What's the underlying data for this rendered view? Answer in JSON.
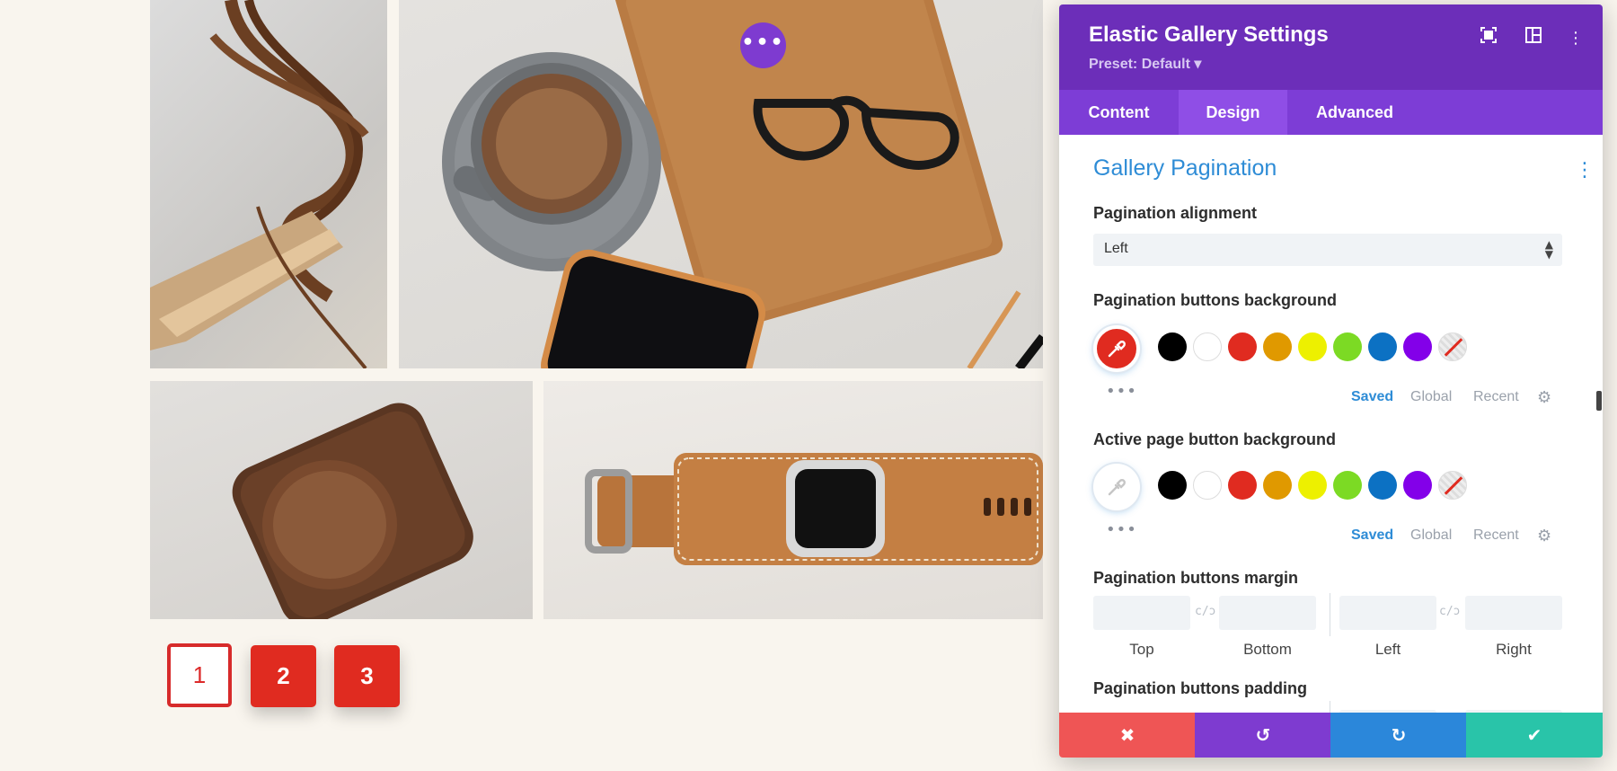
{
  "gallery": {
    "images": [
      "leather-laces-photo",
      "coffee-notebook-glasses-photo",
      "leather-camera-case-photo",
      "leather-watch-strap-photo"
    ],
    "edit_icon": "more-horizontal-icon",
    "pagination": [
      "1",
      "2",
      "3"
    ],
    "active_page": "1",
    "colors": {
      "button_red": "#e02b20",
      "active_border": "#d72b2b"
    }
  },
  "panel": {
    "title": "Elastic Gallery Settings",
    "preset": "Preset: Default ▾",
    "header_icons": [
      "expand-icon",
      "split-view-icon",
      "kebab-menu-icon"
    ],
    "tabs": [
      "Content",
      "Design",
      "Advanced"
    ],
    "active_tab": "Design",
    "section_title": "Gallery Pagination",
    "alignment": {
      "label": "Pagination alignment",
      "value": "Left"
    },
    "buttons_background": {
      "label": "Pagination buttons background",
      "selected_color": "#e02b20"
    },
    "active_background": {
      "label": "Active page button background",
      "selected_color": "#ffffff"
    },
    "swatches": [
      "#000000",
      "#ffffff",
      "#e02b20",
      "#e09900",
      "#edf000",
      "#7cda24",
      "#0c71c3",
      "#8300e9"
    ],
    "color_tabs": {
      "saved": "Saved",
      "global": "Global",
      "recent": "Recent"
    },
    "margin": {
      "label": "Pagination buttons margin",
      "fields": [
        "Top",
        "Bottom",
        "Left",
        "Right"
      ],
      "link_glyph": "c/ɔ"
    },
    "padding": {
      "label": "Pagination buttons padding"
    },
    "footer_icons": [
      "close-icon",
      "undo-icon",
      "redo-icon",
      "check-icon"
    ],
    "colors": {
      "header": "#6c2eb9",
      "tabs": "#7d3dd6",
      "active_tab": "#8f4ee6",
      "section_title": "#2e8cd6",
      "footer_cancel": "#ef5555",
      "footer_undo": "#7e3bd0",
      "footer_redo": "#2b87da",
      "footer_save": "#29c4a9"
    }
  }
}
